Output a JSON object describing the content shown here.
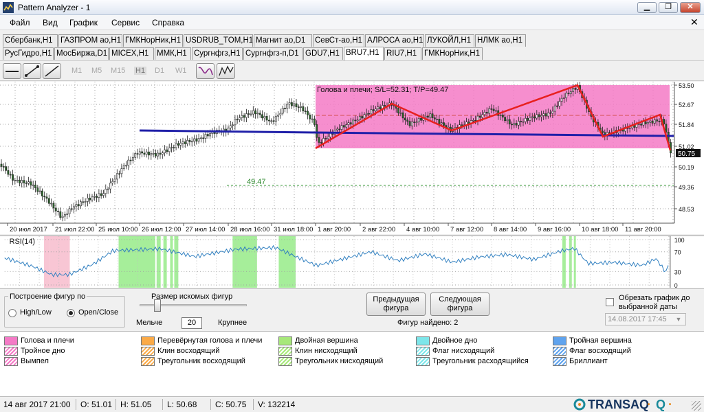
{
  "window": {
    "title": "Pattern Analyzer - 1"
  },
  "menu": [
    "Файл",
    "Вид",
    "График",
    "Сервис",
    "Справка"
  ],
  "tabs_row1": [
    "Сбербанк,H1",
    "ГАЗПРОМ ао,H1",
    "ГМКНорНик,H1",
    "USDRUB_TOM,H1",
    "Магнит ао,D1",
    "СевСт-ао,H1",
    "АЛРОСА ао,H1",
    "ЛУКОЙЛ,H1",
    "НЛМК ао,H1"
  ],
  "tabs_row2": [
    "РусГидро,H1",
    "МосБиржа,D1",
    "MICEX,H1",
    "ММК,H1",
    "Сургнфгз,H1",
    "Сургнфгз-п,D1",
    "GDU7,H1",
    "BRU7,H1",
    "RIU7,H1",
    "ГМКНорНик,H1"
  ],
  "active_tab": "BRU7,H1",
  "timeframes": [
    "M1",
    "M5",
    "M15",
    "H1",
    "D1",
    "W1"
  ],
  "chart": {
    "pattern_label": "Голова и плечи; S/L=52.31; T/P=49.47",
    "target_label": "49.47",
    "last_price_label": "50.75",
    "price_labels": [
      "53.50",
      "52.67",
      "51.84",
      "51.02",
      "50.19",
      "49.36",
      "48.53"
    ],
    "date_labels": [
      "20 июл 2017",
      "21 июл 22:00",
      "25 июл 10:00",
      "26 июл 12:00",
      "27 июл 14:00",
      "28 июл 16:00",
      "31 июл 18:00",
      "1 авг 20:00",
      "2 авг 22:00",
      "4 авг 10:00",
      "7 авг 12:00",
      "8 авг 14:00",
      "9 авг 16:00",
      "10 авг 18:00",
      "11 авг 20:00"
    ],
    "pattern_color": "#f47ac6",
    "neckline_color": "#1f1fa8",
    "zigzag_color": "#e8201f",
    "candle_color": "#2b6a2b"
  },
  "rsi": {
    "title": "RSI(14)",
    "levels": [
      "100",
      "70",
      "30",
      "0"
    ]
  },
  "controls": {
    "shape_group_label": "Построение фигур по",
    "opt_highlow": "High/Low",
    "opt_openclose": "Open/Close",
    "size_label": "Размер искомых фигур",
    "smaller": "Мельче",
    "bigger": "Крупнее",
    "size_value": "20",
    "prev_button": "Предыдущая фигура",
    "next_button": "Следующая фигура",
    "found_text": "Фигур найдено: 2",
    "cut_label": "Обрезать график до выбранной даты",
    "date_value": "14.08.2017 17:45"
  },
  "legend": [
    {
      "label": "Голова и плечи",
      "color": "#f47ac6",
      "hatch": false
    },
    {
      "label": "Перевёрнутая голова и плечи",
      "color": "#fbaa47",
      "hatch": false
    },
    {
      "label": "Двойная вершина",
      "color": "#a7e87a",
      "hatch": false
    },
    {
      "label": "Двойное дно",
      "color": "#7de6ea",
      "hatch": false
    },
    {
      "label": "Тройная вершина",
      "color": "#5fa3ee",
      "hatch": false
    },
    {
      "label": "Тройное дно",
      "color": "#f47ac6",
      "hatch": true
    },
    {
      "label": "Клин восходящий",
      "color": "#fbaa47",
      "hatch": true
    },
    {
      "label": "Клин нисходящий",
      "color": "#a7e87a",
      "hatch": true
    },
    {
      "label": "Флаг нисходящий",
      "color": "#7de6ea",
      "hatch": true
    },
    {
      "label": "Флаг восходящий",
      "color": "#5fa3ee",
      "hatch": true
    },
    {
      "label": "Вымпел",
      "color": "#f47ac6",
      "hatch": true
    },
    {
      "label": "Треугольник восходящий",
      "color": "#fbaa47",
      "hatch": true
    },
    {
      "label": "Треугольник нисходящий",
      "color": "#a7e87a",
      "hatch": true
    },
    {
      "label": "Треугольник расходящийся",
      "color": "#7de6ea",
      "hatch": true
    },
    {
      "label": "Бриллиант",
      "color": "#5fa3ee",
      "hatch": true
    }
  ],
  "status": {
    "date": "14 авг 2017 21:00",
    "open": "O: 51.01",
    "high": "H: 51.05",
    "low": "L: 50.68",
    "close": "C: 50.75",
    "volume": "V: 132214",
    "brand": "TRANSAQ",
    "brand_accent": "Q"
  }
}
